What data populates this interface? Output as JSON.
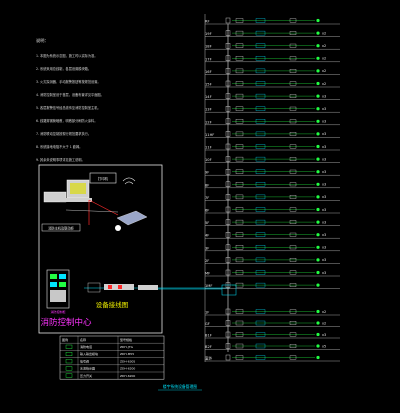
{
  "notes": {
    "title": "说明：",
    "lines": [
      "1. 本图为系统示意图，施工时以实际为准。",
      "2. 系统采用总线制，各层设置模块箱。",
      "3. 火灾探测器、手动报警按钮等按规范设置。",
      "4. 消防控制室设于首层，设备布置详见平面图。",
      "5. 各层报警信号经总线传至消防控制室主机。",
      "6. 线路穿钢管暗敷，明敷部分刷防火涂料。",
      "7. 消防联动控制按现行规范要求执行。",
      "8. 系统接地电阻不大于 1 欧姆。",
      "9. 其余未说明事项详见施工说明。"
    ]
  },
  "floors": [
    {
      "name": "RF",
      "count": ""
    },
    {
      "name": "19F",
      "count": "x2"
    },
    {
      "name": "18F",
      "count": "x2"
    },
    {
      "name": "17F",
      "count": "x2"
    },
    {
      "name": "16F",
      "count": "x2"
    },
    {
      "name": "15F",
      "count": "x2"
    },
    {
      "name": "14F",
      "count": "x3"
    },
    {
      "name": "13F",
      "count": "x3"
    },
    {
      "name": "12F",
      "count": "x3"
    },
    {
      "name": "11HF",
      "count": "x3"
    },
    {
      "name": "11F",
      "count": "x3"
    },
    {
      "name": "10F",
      "count": "x3"
    },
    {
      "name": "9F",
      "count": "x3"
    },
    {
      "name": "8F",
      "count": "x3"
    },
    {
      "name": "7F",
      "count": "x3"
    },
    {
      "name": "6F",
      "count": "x3"
    },
    {
      "name": "5F",
      "count": "x3"
    },
    {
      "name": "4F",
      "count": "x3"
    },
    {
      "name": "3F",
      "count": "x3"
    },
    {
      "name": "2F",
      "count": "x3"
    },
    {
      "name": "MF",
      "count": "x3"
    },
    {
      "name": "1MF",
      "count": ""
    }
  ],
  "basement": [
    {
      "name": "1F",
      "count": "x2"
    },
    {
      "name": "GF",
      "count": "x2"
    },
    {
      "name": "B1F",
      "count": "x3"
    },
    {
      "name": "B2F",
      "count": "x5"
    },
    {
      "name": "室外",
      "count": ""
    }
  ],
  "equipment": {
    "printer_label": "打印机",
    "computer_label": "消防主机及联动柜",
    "link_label": "设备接线图",
    "room_label": "消防控制中心",
    "cabinet_label": "消防控制柜"
  },
  "legend": {
    "header": [
      "图例",
      "名称",
      "型号规格"
    ],
    "rows": [
      [
        "",
        "消防电话",
        "ZDH-JTG"
      ],
      [
        "",
        "输入输出模块",
        "ZDH-M55"
      ],
      [
        "",
        "信号阀",
        "ZDH-6305"
      ],
      [
        "",
        "水流指示器",
        "ZDH-6200"
      ],
      [
        "",
        "压力开关",
        "ZDH-6200"
      ]
    ]
  },
  "footer_title": "楼宇系统设备管理图",
  "colors": {
    "cyan": "#00e5ff",
    "green": "#22ff44",
    "red": "#ff2a2a",
    "white": "#e8e8e8",
    "yellow": "#f2f200",
    "magenta": "#ff33ff"
  }
}
